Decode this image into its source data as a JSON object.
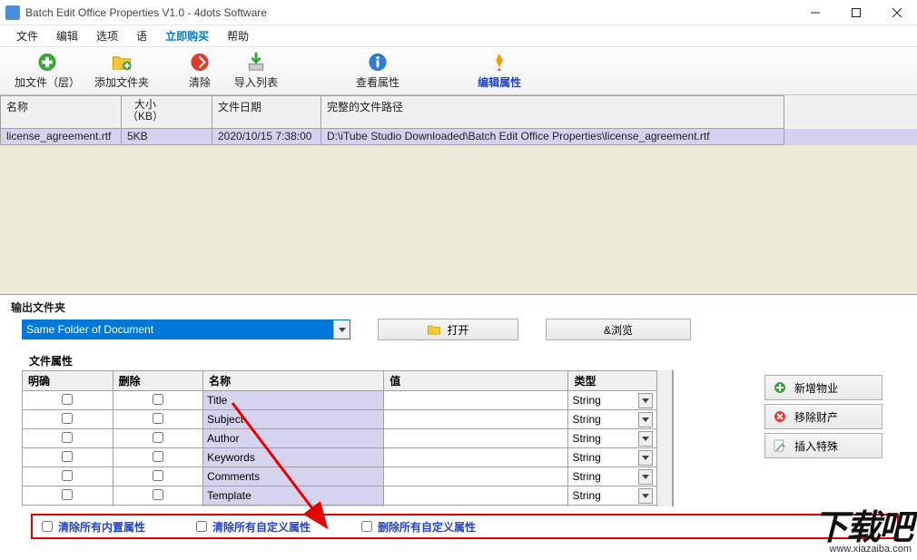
{
  "window": {
    "title": "Batch Edit Office Properties V1.0 - 4dots Software"
  },
  "menu": {
    "file": "文件",
    "edit": "编辑",
    "options": "选项",
    "lang": "语",
    "buy": "立即购买",
    "help": "帮助"
  },
  "toolbar": {
    "add_file": "加文件（层）",
    "add_folder": "添加文件夹",
    "clear": "清除",
    "import_list": "导入列表",
    "view_props": "查看属性",
    "edit_props": "编辑属性"
  },
  "filelist": {
    "hdr_name": "名称",
    "hdr_size": "大小\n（KB）",
    "hdr_date": "文件日期",
    "hdr_path": "完整的文件路径",
    "row": {
      "name": "license_agreement.rtf",
      "size": "5KB",
      "date": "2020/10/15 7:38:00",
      "path": "D:\\iTube Studio Downloaded\\Batch Edit Office Properties\\license_agreement.rtf"
    }
  },
  "output": {
    "section": "输出文件夹",
    "value": "Same Folder of Document",
    "open": "打开",
    "browse": "&浏览"
  },
  "props": {
    "section": "文件属性",
    "hdr_clear": "明确",
    "hdr_delete": "删除",
    "hdr_name": "名称",
    "hdr_value": "值",
    "hdr_type": "类型",
    "rows": [
      {
        "name": "Title",
        "type": "String"
      },
      {
        "name": "Subject",
        "type": "String"
      },
      {
        "name": "Author",
        "type": "String"
      },
      {
        "name": "Keywords",
        "type": "String"
      },
      {
        "name": "Comments",
        "type": "String"
      },
      {
        "name": "Template",
        "type": "String"
      }
    ]
  },
  "side": {
    "add": "新增物业",
    "remove": "移除财产",
    "insert": "插入特殊"
  },
  "bottom": {
    "clear_builtin": "清除所有内置属性",
    "clear_custom": "清除所有自定义属性",
    "delete_custom": "删除所有自定义属性"
  },
  "watermark": {
    "text": "下载吧",
    "url": "www.xiazaiba.com"
  }
}
